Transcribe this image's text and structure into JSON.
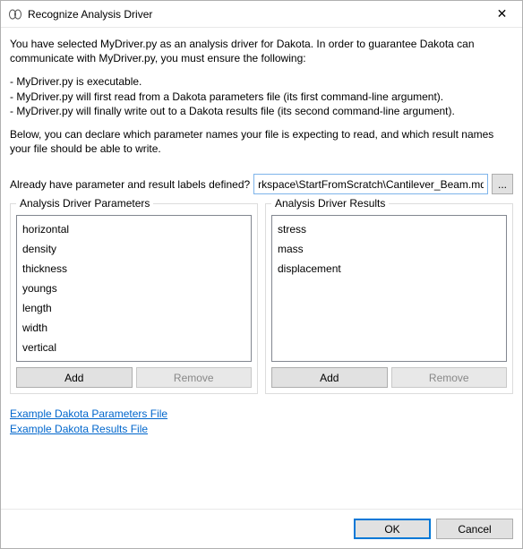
{
  "window": {
    "title": "Recognize Analysis Driver",
    "close_glyph": "✕"
  },
  "intro": {
    "p1": "You have selected MyDriver.py as an analysis driver for Dakota.  In order to guarantee Dakota can communicate with MyDriver.py, you must ensure the following:",
    "bullets": [
      "- MyDriver.py is executable.",
      "- MyDriver.py will first read from a Dakota parameters file (its first command-line argument).",
      "- MyDriver.py will finally write out to a Dakota results file (its second command-line argument)."
    ],
    "p2": "Below, you can declare which parameter names your file is expecting to read, and which result names your file should be able to write."
  },
  "def": {
    "label": "Already have parameter and result labels defined?",
    "path": "rkspace\\StartFromScratch\\Cantilever_Beam.mdf",
    "browse_label": "..."
  },
  "panels": {
    "params": {
      "title": "Analysis Driver Parameters",
      "items": [
        "horizontal",
        "density",
        "thickness",
        "youngs",
        "length",
        "width",
        "vertical"
      ],
      "add_label": "Add",
      "remove_label": "Remove"
    },
    "results": {
      "title": "Analysis Driver Results",
      "items": [
        "stress",
        "mass",
        "displacement"
      ],
      "add_label": "Add",
      "remove_label": "Remove"
    }
  },
  "links": {
    "example_params": "Example Dakota Parameters File",
    "example_results": "Example Dakota Results File"
  },
  "footer": {
    "ok": "OK",
    "cancel": "Cancel"
  }
}
